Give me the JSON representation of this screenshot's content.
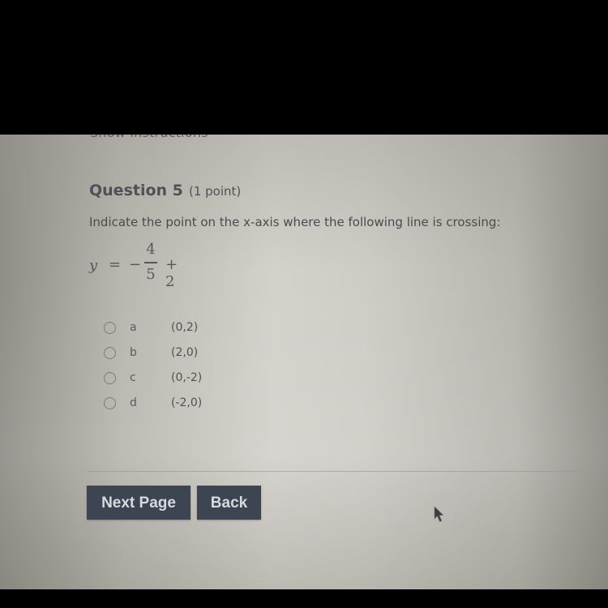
{
  "header": {
    "show_instructions_label": "Show Instructions"
  },
  "question": {
    "title": "Question 5",
    "points": "(1 point)",
    "prompt": "Indicate the point on the x-axis where the following line is crossing:",
    "equation": {
      "lhs": "y",
      "equals": "=",
      "sign": "−",
      "numerator": "4",
      "denominator": "5",
      "constant": "+ 2"
    }
  },
  "options": [
    {
      "letter": "a",
      "value": "(0,2)",
      "selected": false
    },
    {
      "letter": "b",
      "value": "(2,0)",
      "selected": false
    },
    {
      "letter": "c",
      "value": "(0,-2)",
      "selected": false
    },
    {
      "letter": "d",
      "value": "(-2,0)",
      "selected": false
    }
  ],
  "buttons": {
    "next_page": "Next Page",
    "back": "Back"
  },
  "colors": {
    "button_bg": "#3e4552",
    "button_text": "#d9dadd",
    "text": "#4f5157"
  },
  "icons": {
    "cursor": "mouse-pointer-icon",
    "radio": "radio-unchecked-icon"
  }
}
